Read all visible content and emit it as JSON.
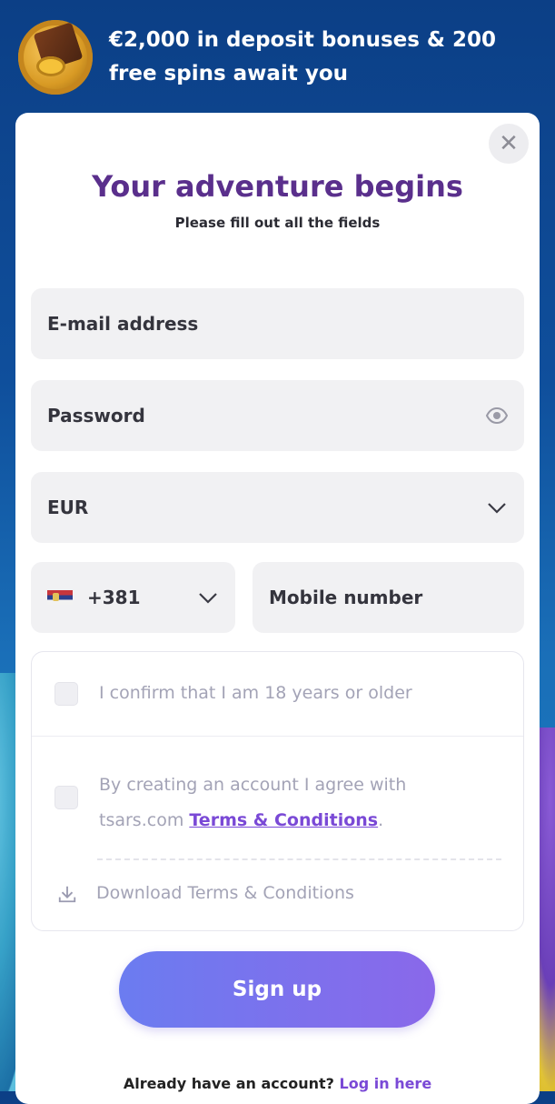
{
  "promo": {
    "line1": "€2,000 in deposit bonuses & 200",
    "line2": "free spins await you"
  },
  "modal": {
    "close_symbol": "✕",
    "title": "Your adventure begins",
    "subtitle": "Please fill out all the fields"
  },
  "form": {
    "email_placeholder": "E-mail address",
    "password_placeholder": "Password",
    "currency_value": "EUR",
    "country_code": "+381",
    "mobile_placeholder": "Mobile number"
  },
  "consent": {
    "age_text": "I confirm that I am 18 years or older",
    "terms_prefix": "By creating an account I agree with tsars.com ",
    "terms_link": "Terms & Conditions",
    "terms_suffix": ".",
    "download_text": "Download Terms & Conditions"
  },
  "actions": {
    "signup_label": "Sign up",
    "login_prompt": "Already have an account?",
    "login_link": "Log in here"
  },
  "icons": {
    "eye": "eye-icon",
    "chevron": "chevron-down-icon",
    "download": "download-icon",
    "close": "close-icon",
    "flag": "serbia-flag-icon"
  },
  "colors": {
    "accent": "#7a49d6",
    "title": "#5a2f8c",
    "button_start": "#6b7cf0",
    "button_end": "#8a68ea"
  }
}
